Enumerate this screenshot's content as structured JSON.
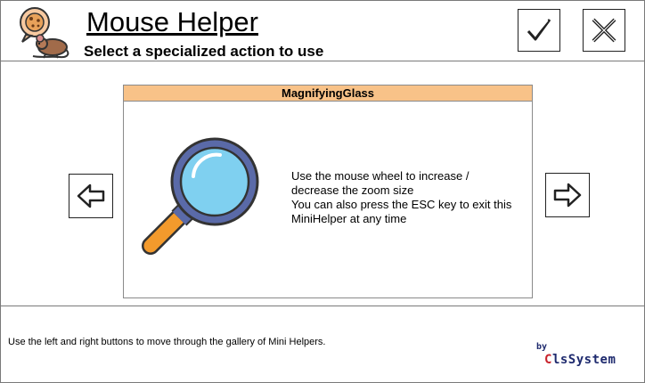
{
  "header": {
    "title": "Mouse Helper",
    "subtitle": "Select a specialized action to use",
    "logo_icon": "mouse-with-cookie-icon",
    "ok_icon": "checkmark-icon",
    "close_icon": "close-x-icon"
  },
  "card": {
    "title": "MagnifyingGlass",
    "image_icon": "magnifying-glass-icon",
    "description_lines": [
      "Use the mouse wheel to increase /",
      "decrease the zoom size",
      "You can also press the ESC key to exit this",
      "MiniHelper at any time"
    ]
  },
  "navigation": {
    "prev_icon": "arrow-left-icon",
    "next_icon": "arrow-right-icon"
  },
  "footer": {
    "hint": "Use the left and right buttons to move through the gallery of Mini Helpers.",
    "by_label": "by",
    "brand_first": "C",
    "brand_rest": "lsSystem"
  },
  "colors": {
    "card_header_bg": "#f8c288",
    "brand_red": "#c8232c",
    "brand_navy": "#1e2a6e",
    "lens_blue": "#7fd0f0",
    "handle_orange": "#f39a2c"
  }
}
